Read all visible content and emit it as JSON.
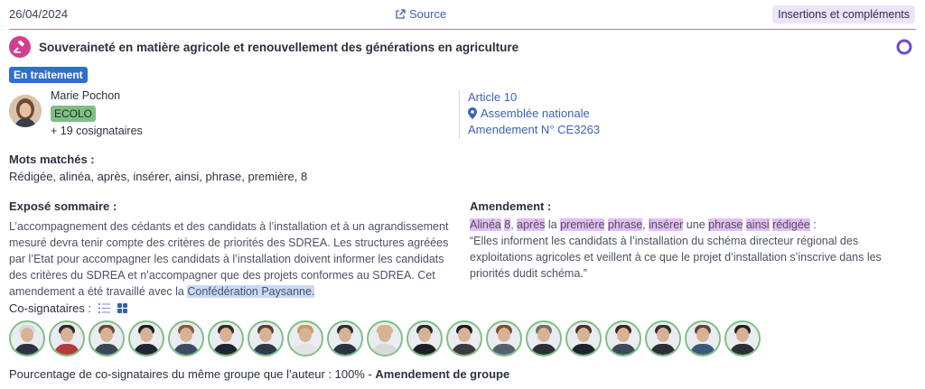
{
  "header": {
    "date": "26/04/2024",
    "source_label": "Source",
    "tag": "Insertions et compléments"
  },
  "title": "Souveraineté en matière agricole et renouvellement des générations en agriculture",
  "status": "En traitement",
  "author": {
    "name": "Marie Pochon",
    "party": "ECOLO",
    "cosignataires": "+ 19 cosignataires"
  },
  "info": {
    "article": "Article 10",
    "assembly": "Assemblée nationale",
    "amendment": "Amendement N° CE3263"
  },
  "mots": {
    "label": "Mots matchés :",
    "value": "Rédigée, alinéa, après, insérer, ainsi, phrase, première, 8"
  },
  "expose": {
    "label": "Exposé sommaire :",
    "text": "L’accompagnement des cédants et des candidats à l’installation et à un agrandissement mesuré devra tenir compte des critères de priorités des SDREA. Les structures agréées par l’Etat pour accompagner les candidats à l’installation doivent informer les candidats des critères du SDREA et n’accompagner que des projets conformes au SDREA. Cet amendement a été travaillé avec la ",
    "highlight": "Confédération Paysanne."
  },
  "amendement": {
    "label": "Amendement :",
    "tokens": [
      {
        "t": "Alinéa",
        "h": true
      },
      {
        "t": " ",
        "h": false
      },
      {
        "t": "8",
        "h": true
      },
      {
        "t": ", ",
        "h": false
      },
      {
        "t": "après",
        "h": true
      },
      {
        "t": " la ",
        "h": false
      },
      {
        "t": "première",
        "h": true
      },
      {
        "t": " ",
        "h": false
      },
      {
        "t": "phrase",
        "h": true
      },
      {
        "t": ", ",
        "h": false
      },
      {
        "t": "insérer",
        "h": true
      },
      {
        "t": " une ",
        "h": false
      },
      {
        "t": "phrase",
        "h": true
      },
      {
        "t": " ",
        "h": false
      },
      {
        "t": "ainsi",
        "h": true
      },
      {
        "t": " ",
        "h": false
      },
      {
        "t": "rédigée",
        "h": true
      },
      {
        "t": " :",
        "h": false
      }
    ],
    "quote": "“Elles informent les candidats à l’installation du schéma directeur régional des exploitations agricoles et veillent à ce que le projet d’installation s’inscrive dans les priorités dudit schéma.”"
  },
  "cosignataires": {
    "label": "Co-signataires :",
    "count": 19
  },
  "footer": {
    "text": "Pourcentage de co-signataires du même groupe que l’auteur : 100% - ",
    "bold": "Amendement de groupe"
  },
  "colors": {
    "accent": "#e7619a",
    "party": "#7fbf84",
    "link": "#3d63b8",
    "highlight_blue": "#c8daf5",
    "highlight_purple": "#e3bdf0"
  }
}
